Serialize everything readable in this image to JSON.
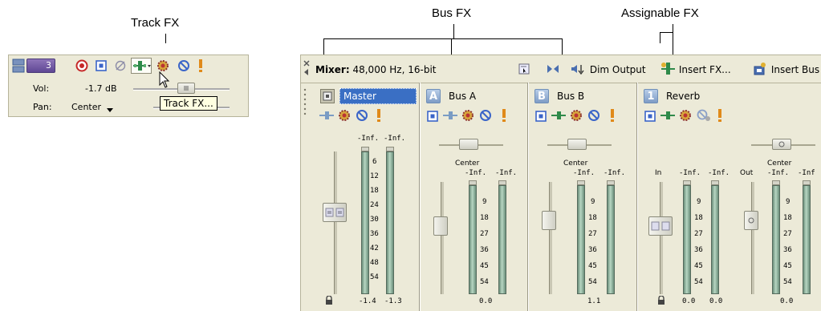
{
  "callouts": {
    "track_fx": "Track FX",
    "bus_fx": "Bus FX",
    "assignable_fx": "Assignable FX"
  },
  "track": {
    "number": "3",
    "vol_label": "Vol:",
    "vol_value": "-1.7 dB",
    "pan_label": "Pan:",
    "pan_value": "Center",
    "tooltip": "Track FX..."
  },
  "mixer": {
    "title_bold": "Mixer:",
    "title_rest": " 48,000 Hz, 16-bit",
    "toolbar": {
      "dim_output": "Dim Output",
      "insert_fx": "Insert FX...",
      "insert_bus": "Insert Bus"
    },
    "strips": {
      "master": {
        "name": "Master",
        "peak_left": "-Inf.",
        "peak_right": "-Inf.",
        "readout_left": "-1.4",
        "readout_right": "-1.3"
      },
      "bus_a": {
        "badge": "A",
        "name": "Bus A",
        "pan": "Center",
        "peak_left": "-Inf.",
        "peak_right": "-Inf.",
        "readout": "0.0"
      },
      "bus_b": {
        "badge": "B",
        "name": "Bus B",
        "pan": "Center",
        "peak_left": "-Inf.",
        "peak_right": "-Inf.",
        "readout": "1.1"
      },
      "reverb": {
        "badge": "1",
        "name": "Reverb",
        "in_label": "In",
        "out_label": "Out",
        "pan": "Center",
        "in_peak_left": "-Inf.",
        "in_peak_right": "-Inf.",
        "out_peak_left": "-Inf.",
        "out_peak_right": "-Inf",
        "in_readout_left": "0.0",
        "in_readout_right": "0.0",
        "out_readout": "0.0"
      }
    },
    "master_ticks": [
      "6",
      "12",
      "18",
      "24",
      "30",
      "36",
      "42",
      "48",
      "54"
    ],
    "bus_ticks": [
      "9",
      "18",
      "27",
      "36",
      "45",
      "54"
    ]
  },
  "colors": {
    "panel_bg": "#ecead8",
    "meter_green": "#9cc3aa",
    "selected_blue": "#3a6fc4",
    "record_red": "#d23a3a",
    "mute_blue": "#3a64c8",
    "solo_orange": "#e08a1a"
  }
}
